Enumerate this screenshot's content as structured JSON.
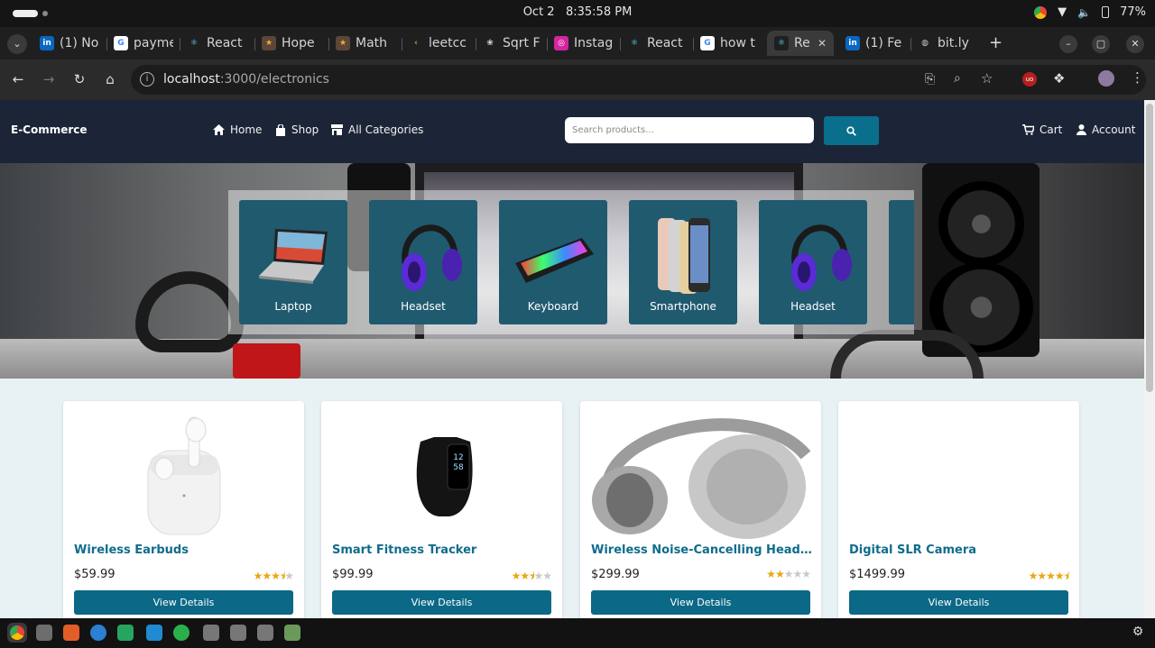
{
  "os": {
    "date": "Oct 2",
    "time": "8:35:58 PM",
    "battery": "77%"
  },
  "tabs": [
    {
      "label": "(1) No",
      "favicon": "linkedin-icon"
    },
    {
      "label": "payme",
      "favicon": "google-icon"
    },
    {
      "label": "React",
      "favicon": "react-icon"
    },
    {
      "label": "Hope",
      "favicon": "codechef-icon"
    },
    {
      "label": "Math",
      "favicon": "codechef-icon"
    },
    {
      "label": "leetcc",
      "favicon": "leetcode-icon"
    },
    {
      "label": "Sqrt F",
      "favicon": "openai-icon"
    },
    {
      "label": "Instag",
      "favicon": "instagram-icon"
    },
    {
      "label": "React",
      "favicon": "react-icon"
    },
    {
      "label": "how t",
      "favicon": "google-icon"
    },
    {
      "label": "Re",
      "favicon": "react-icon",
      "active": true
    },
    {
      "label": "(1) Fe",
      "favicon": "linkedin-icon"
    },
    {
      "label": "bit.ly",
      "favicon": "globe-icon"
    }
  ],
  "address": {
    "host": "localhost",
    "path": ":3000/electronics"
  },
  "header": {
    "brand": "E-Commerce",
    "nav_home": "Home",
    "nav_shop": "Shop",
    "nav_categories": "All Categories",
    "search_placeholder": "Search products...",
    "cart": "Cart",
    "account": "Account"
  },
  "categories": [
    "Laptop",
    "Headset",
    "Keyboard",
    "Smartphone",
    "Headset"
  ],
  "products": [
    {
      "name": "Wireless Earbuds",
      "price": "$59.99",
      "rating": 3.5,
      "button": "View Details"
    },
    {
      "name": "Smart Fitness Tracker",
      "price": "$99.99",
      "rating": 2.5,
      "button": "View Details"
    },
    {
      "name": "Wireless Noise-Cancelling Headphones",
      "price": "$299.99",
      "rating": 2,
      "button": "View Details"
    },
    {
      "name": "Digital SLR Camera",
      "price": "$1499.99",
      "rating": 4.5,
      "button": "View Details"
    }
  ],
  "colors": {
    "header_bg": "#1c2537",
    "accent": "#0b6886",
    "title": "#0f6c8c",
    "star": "#e9a713",
    "page_bg": "#e8f1f3"
  }
}
